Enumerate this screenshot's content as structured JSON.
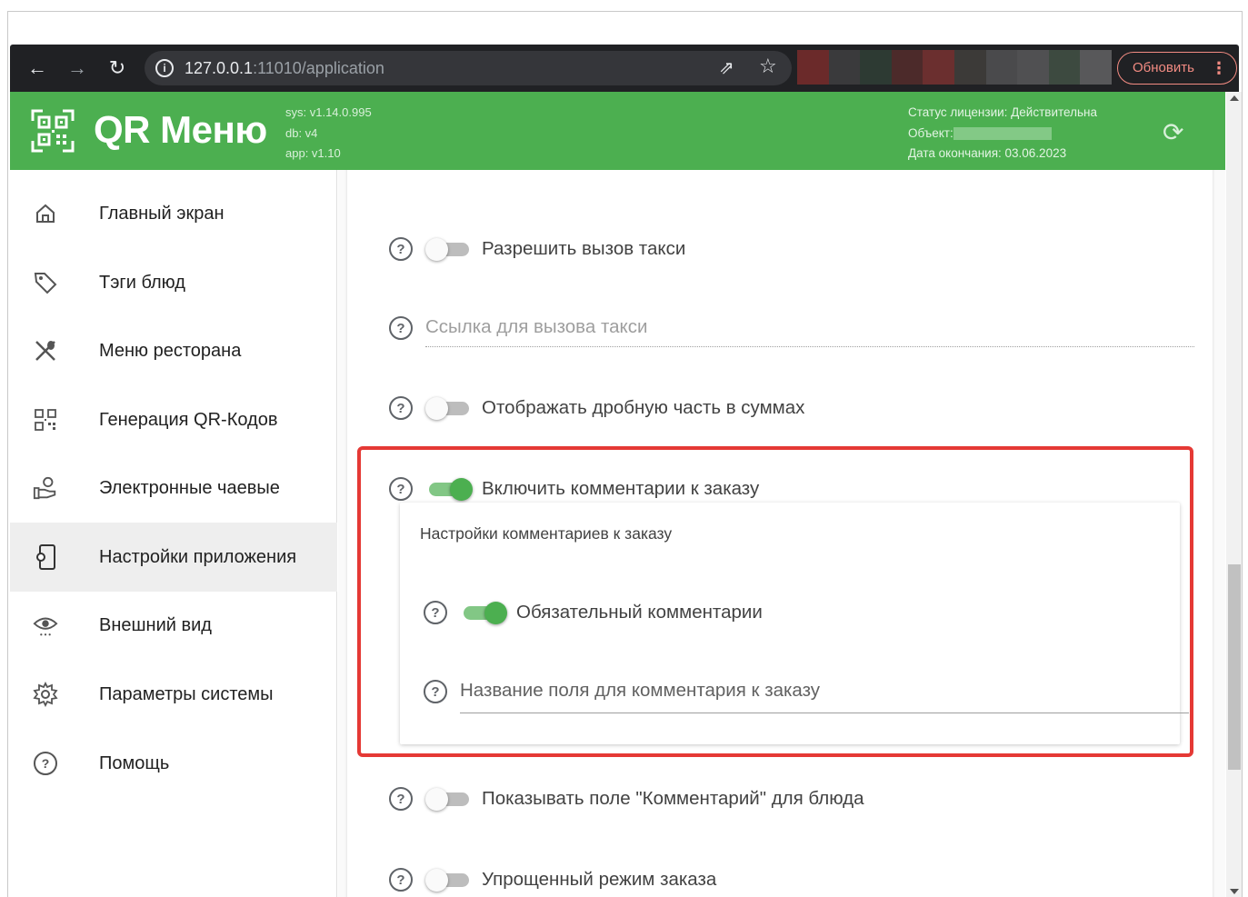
{
  "browser": {
    "url_host": "127.0.0.1",
    "url_rest": ":11010/application",
    "update_label": "Обновить"
  },
  "header": {
    "title": "QR Меню",
    "versions": [
      "sys: v1.14.0.995",
      "db: v4",
      "app: v1.10"
    ],
    "license_status": "Статус лицензии: Действительна",
    "object_label": "Объект:",
    "expiry": "Дата окончания: 03.06.2023"
  },
  "sidebar": {
    "items": [
      {
        "label": "Главный экран",
        "icon": "home-icon"
      },
      {
        "label": "Тэги блюд",
        "icon": "tag-icon"
      },
      {
        "label": "Меню ресторана",
        "icon": "cutlery-icon"
      },
      {
        "label": "Генерация QR-Кодов",
        "icon": "qr-code-icon"
      },
      {
        "label": "Электронные чаевые",
        "icon": "tips-icon"
      },
      {
        "label": "Настройки приложения",
        "icon": "app-settings-icon",
        "active": true
      },
      {
        "label": "Внешний вид",
        "icon": "eye-icon"
      },
      {
        "label": "Параметры системы",
        "icon": "gear-icon"
      },
      {
        "label": "Помощь",
        "icon": "help-icon"
      }
    ]
  },
  "settings": {
    "taxi_call": {
      "label": "Разрешить вызов такси",
      "enabled": false
    },
    "taxi_link": {
      "placeholder": "Ссылка для вызова такси"
    },
    "show_fraction": {
      "label": "Отображать дробную часть в суммах",
      "enabled": false
    },
    "order_comments": {
      "label": "Включить комментарии к заказу",
      "enabled": true
    },
    "comments_panel": {
      "title": "Настройки комментариев к заказу",
      "required": {
        "label": "Обязательный комментарии",
        "enabled": true
      },
      "field_name": {
        "placeholder": "Название поля для комментария к заказу"
      }
    },
    "dish_comment": {
      "label": "Показывать поле \"Комментарий\" для блюда",
      "enabled": false
    },
    "simple_mode": {
      "label": "Упрощенный режим заказа",
      "enabled": false
    }
  },
  "colors": {
    "accent": "#4caf50",
    "highlight": "#e53935"
  }
}
